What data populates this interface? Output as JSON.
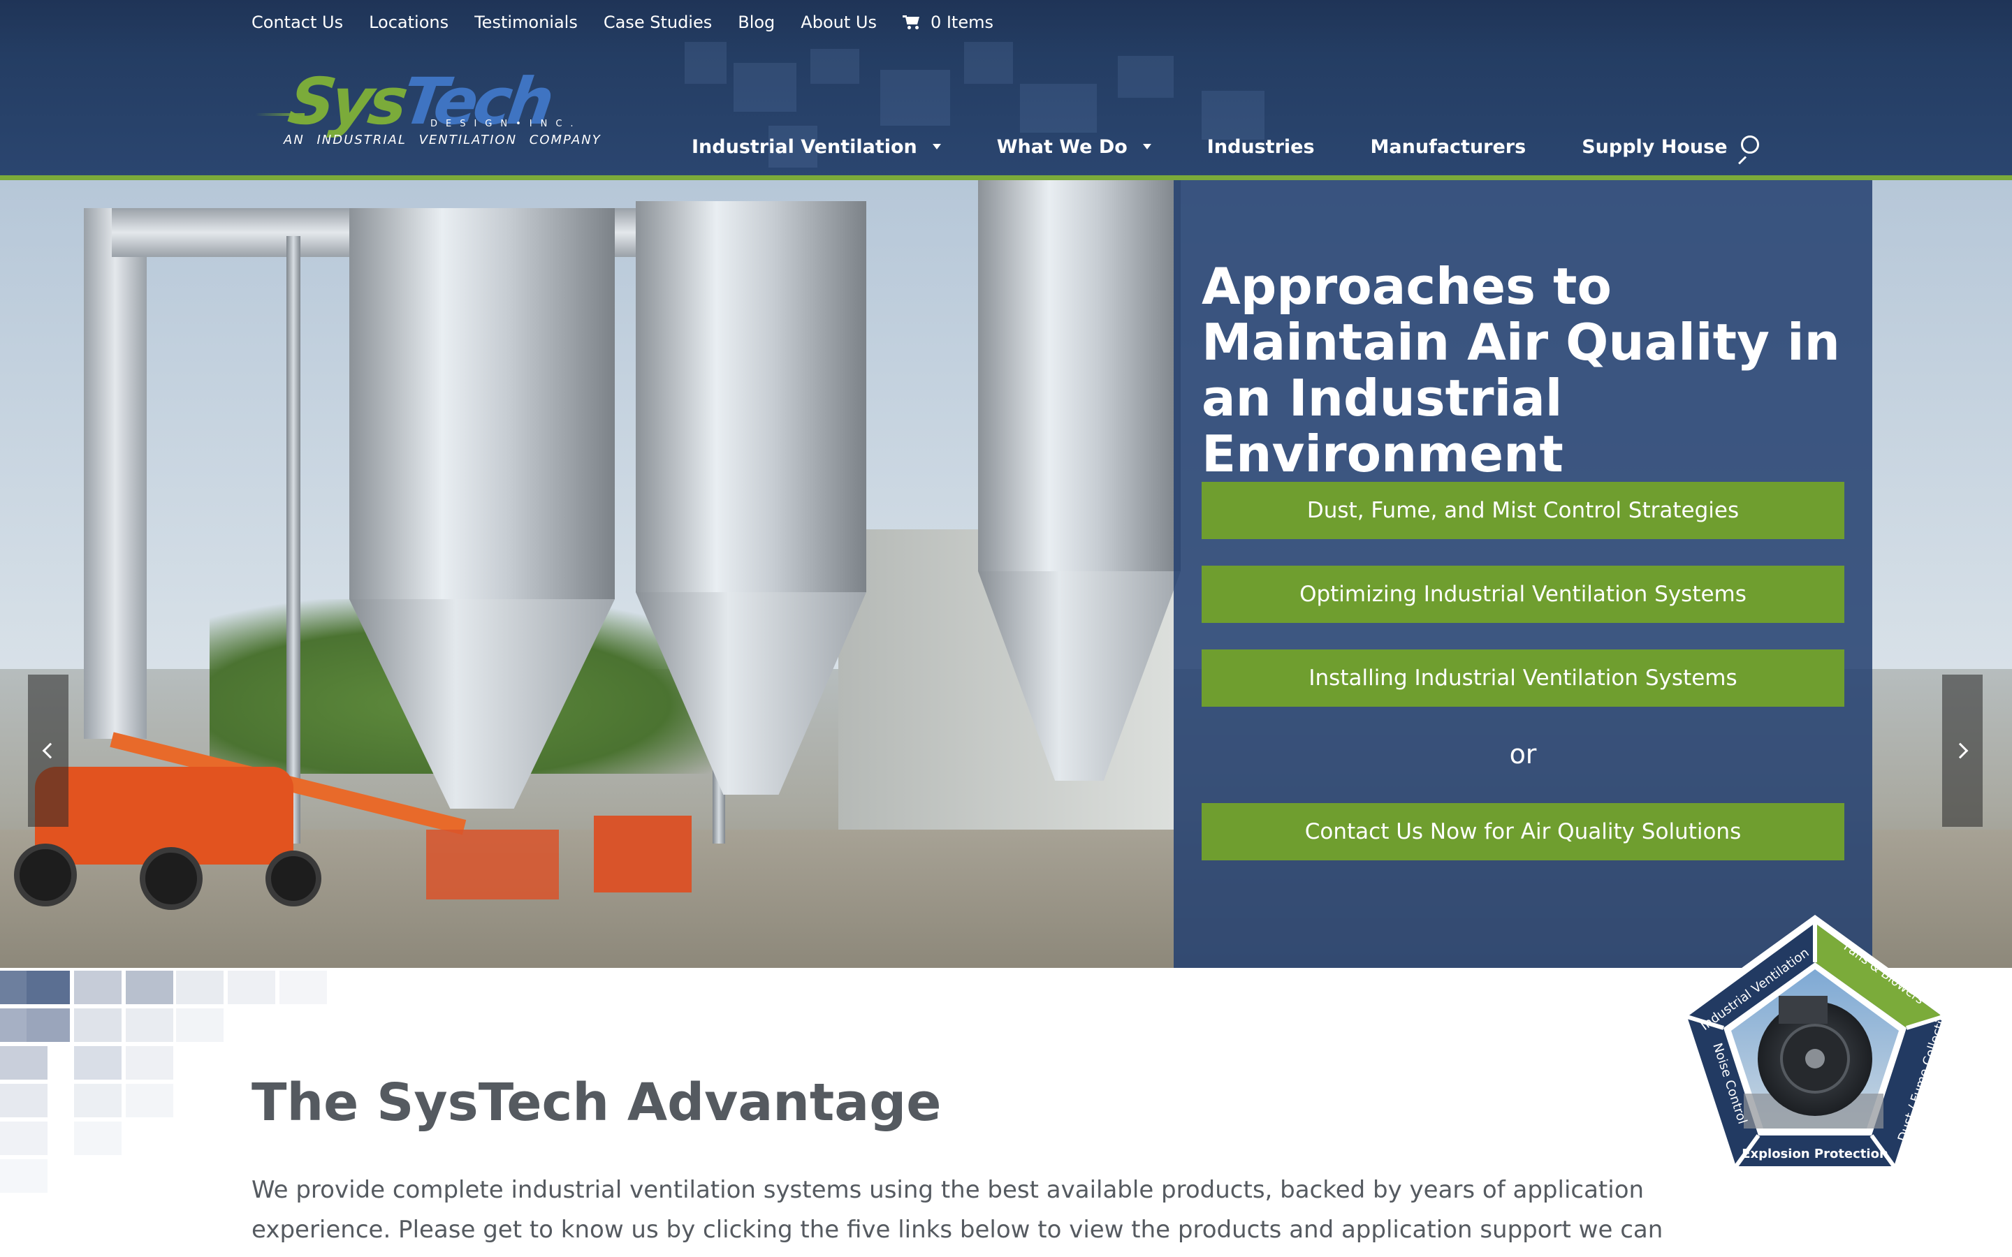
{
  "topnav": {
    "items": [
      "Contact Us",
      "Locations",
      "Testimonials",
      "Case Studies",
      "Blog",
      "About Us"
    ],
    "cart_label": "0 Items"
  },
  "logo": {
    "sys": "Sys",
    "tech": "Tech",
    "design": "DESIGN•INC.",
    "tagline": "AN INDUSTRIAL VENTILATION COMPANY"
  },
  "mainnav": {
    "items": [
      {
        "label": "Industrial Ventilation",
        "has_dropdown": true
      },
      {
        "label": "What We Do",
        "has_dropdown": true
      },
      {
        "label": "Industries",
        "has_dropdown": false
      },
      {
        "label": "Manufacturers",
        "has_dropdown": false
      },
      {
        "label": "Supply House",
        "has_dropdown": false
      }
    ],
    "search_icon": "search-icon"
  },
  "hero": {
    "title": "Approaches to Maintain Air Quality in an Industrial Environment",
    "buttons": [
      "Dust, Fume, and Mist Control Strategies",
      "Optimizing Industrial Ventilation Systems",
      "Installing Industrial Ventilation Systems"
    ],
    "or_text": "or",
    "cta": "Contact Us Now for Air Quality Solutions"
  },
  "advantage": {
    "title": "The SysTech Advantage",
    "body": "We provide complete industrial ventilation systems using the best available products, backed by years of application experience. Please get to know us by clicking the five links below to view the products and application support we can provide your company. We use “real-"
  },
  "badge": {
    "segments": [
      "Industrial Ventilation",
      "Fans & Blowers",
      "Dust / Fume Collection",
      "Explosion Protection",
      "Noise Control"
    ],
    "active_segment": "Fans & Blowers"
  },
  "colors": {
    "header_bg": "#243d63",
    "accent_green": "#7bab3a",
    "button_green": "#6f9e2f",
    "panel_blue": "#244070",
    "text_gray": "#555a60"
  }
}
